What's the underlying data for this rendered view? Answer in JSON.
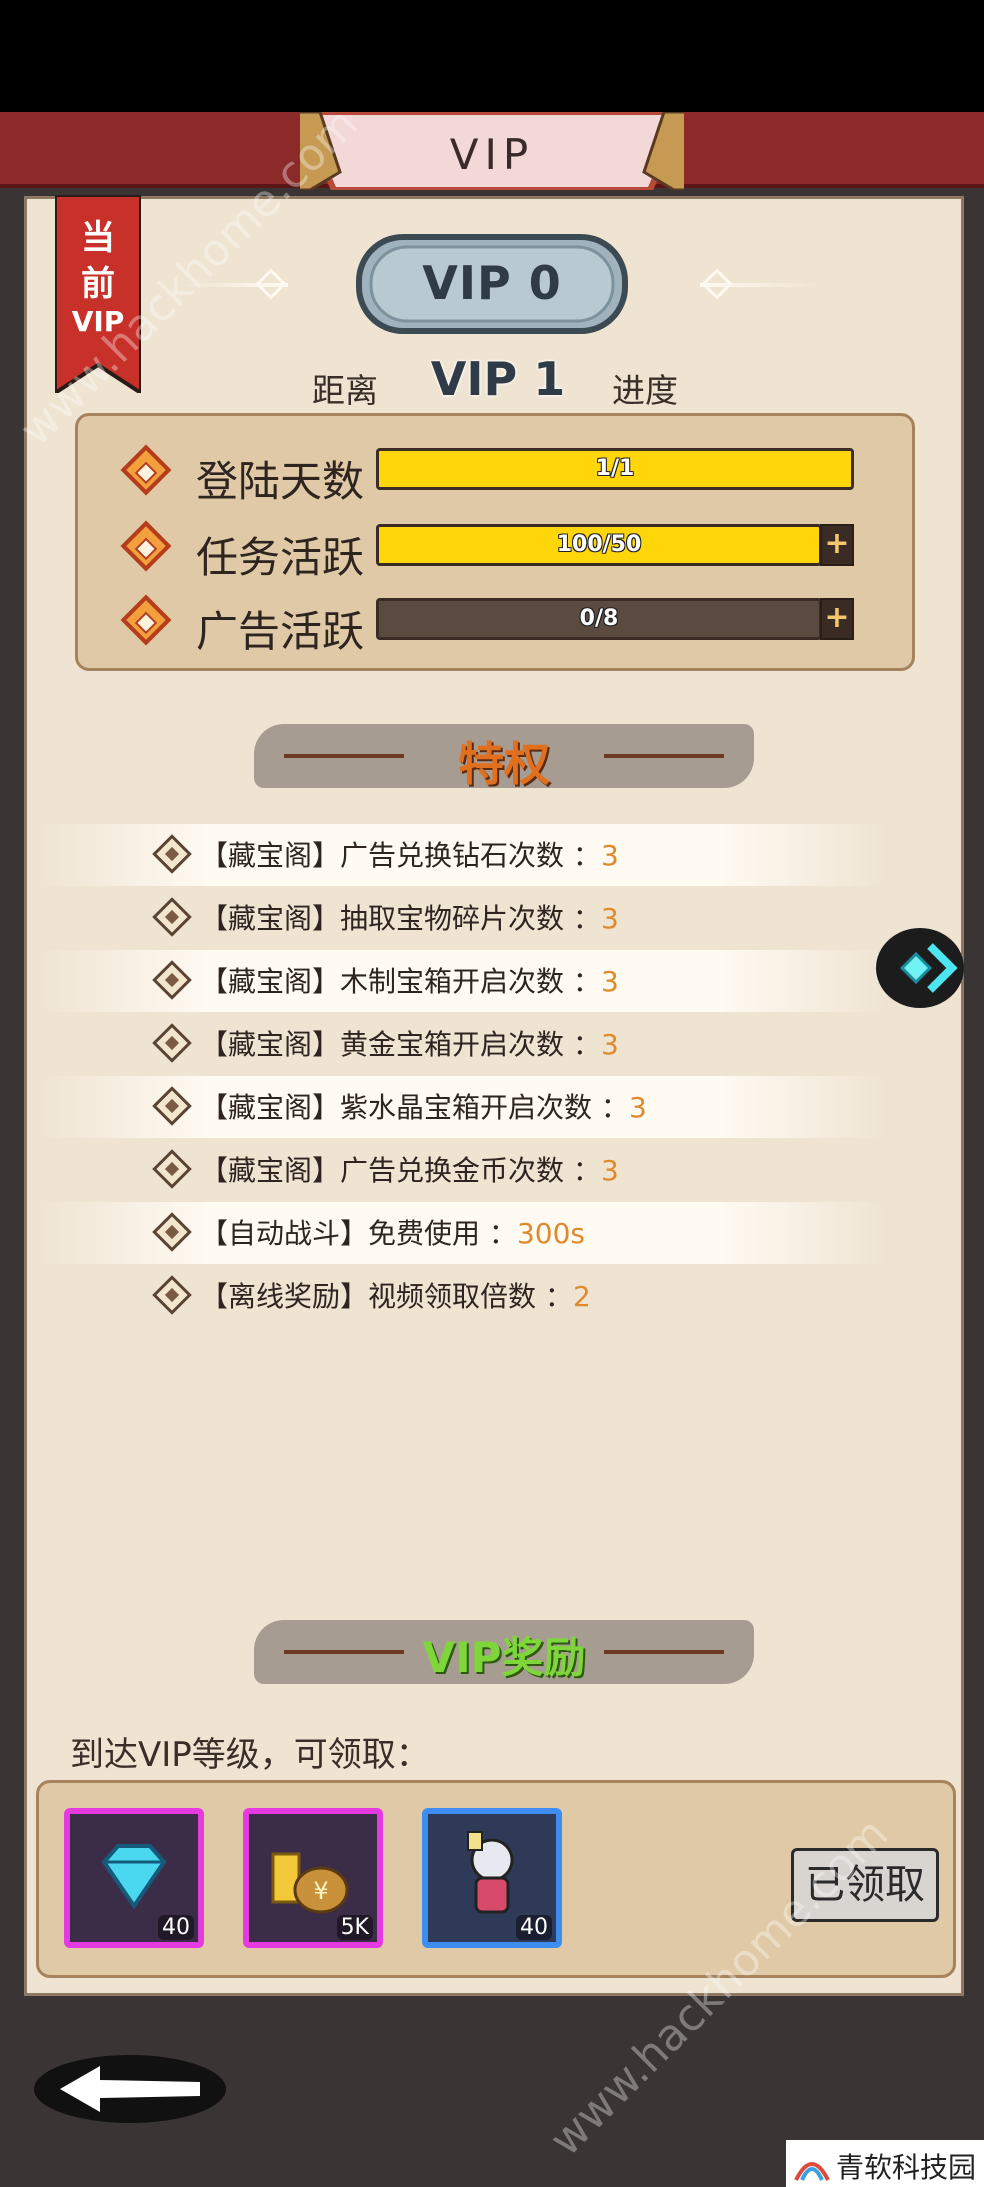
{
  "header": {
    "title": "VIP"
  },
  "ribbon": {
    "line1": "当",
    "line2": "前",
    "line3": "VIP"
  },
  "current_vip": {
    "label": "VIP 0"
  },
  "progress": {
    "prefix": "距离",
    "next_level": "VIP 1",
    "suffix": "进度",
    "rows": [
      {
        "label": "登陆天数",
        "value_text": "1/1",
        "fill": 1.0,
        "has_plus": false
      },
      {
        "label": "任务活跃",
        "value_text": "100/50",
        "fill": 1.0,
        "has_plus": true
      },
      {
        "label": "广告活跃",
        "value_text": "0/8",
        "fill": 0.0,
        "has_plus": true
      }
    ],
    "plus_symbol": "+"
  },
  "privileges": {
    "title": "特权",
    "items": [
      {
        "text": "【藏宝阁】广告兑换钻石次数",
        "sep": "：",
        "value": "3"
      },
      {
        "text": "【藏宝阁】抽取宝物碎片次数",
        "sep": "：",
        "value": "3"
      },
      {
        "text": "【藏宝阁】木制宝箱开启次数",
        "sep": "：",
        "value": "3"
      },
      {
        "text": "【藏宝阁】黄金宝箱开启次数",
        "sep": "：",
        "value": "3"
      },
      {
        "text": "【藏宝阁】紫水晶宝箱开启次数",
        "sep": "：",
        "value": "3"
      },
      {
        "text": "【藏宝阁】广告兑换金币次数",
        "sep": "：",
        "value": "3"
      },
      {
        "text": "【自动战斗】免费使用",
        "sep": "：",
        "value": "300s"
      },
      {
        "text": "【离线奖励】视频领取倍数",
        "sep": "：",
        "value": "2"
      }
    ]
  },
  "rewards": {
    "title": "VIP奖励",
    "caption": "到达VIP等级，可领取：",
    "items": [
      {
        "icon": "diamond-icon",
        "count": "40",
        "rarity": "purple"
      },
      {
        "icon": "gold-coin-bag-icon",
        "count": "5K",
        "rarity": "purple"
      },
      {
        "icon": "hero-character-icon",
        "count": "40",
        "rarity": "blue"
      }
    ],
    "claim_label": "已领取"
  },
  "watermark": {
    "text": "www.hackhome.com",
    "logo_text": "青软科技园"
  },
  "colors": {
    "accent_red": "#8c2a2a",
    "bar_yellow": "#ffd60a",
    "value_orange": "#e08a2e",
    "privilege_title": "#e0701e",
    "reward_title": "#7fd63a",
    "panel_bg": "#efe4d2"
  }
}
